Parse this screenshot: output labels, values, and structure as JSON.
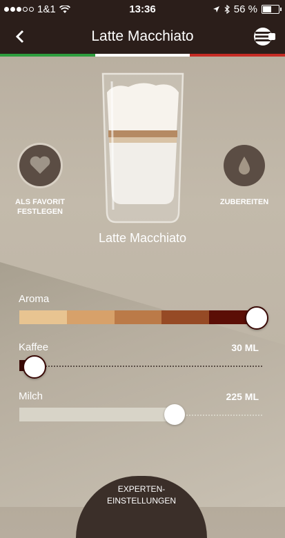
{
  "status_bar": {
    "carrier": "1&1",
    "time": "13:36",
    "battery": "56 %",
    "battery_level": 0.56,
    "signal_bars": 3
  },
  "header": {
    "title": "Latte Macchiato",
    "flag_colors": [
      "#2e9e3e",
      "#ffffff",
      "#c62c25"
    ],
    "bar_color": "#2b1e1a"
  },
  "drink": {
    "name": "Latte Macchiato"
  },
  "actions": {
    "favorite_label_line1": "ALS FAVORIT",
    "favorite_label_line2": "FESTLEGEN",
    "brew_label": "ZUBEREITEN"
  },
  "aroma": {
    "label": "Aroma",
    "segments": [
      "#e8c491",
      "#d7a16a",
      "#bb7a48",
      "#964a25",
      "#5b0e06"
    ],
    "level": 5,
    "max_level": 5
  },
  "kaffee": {
    "label": "Kaffee",
    "value": "30 ML",
    "fraction": 0.05
  },
  "milch": {
    "label": "Milch",
    "value": "225 ML",
    "fraction": 0.64
  },
  "expert_button": {
    "line1": "EXPERTEN-",
    "line2": "EINSTELLUNGEN"
  }
}
